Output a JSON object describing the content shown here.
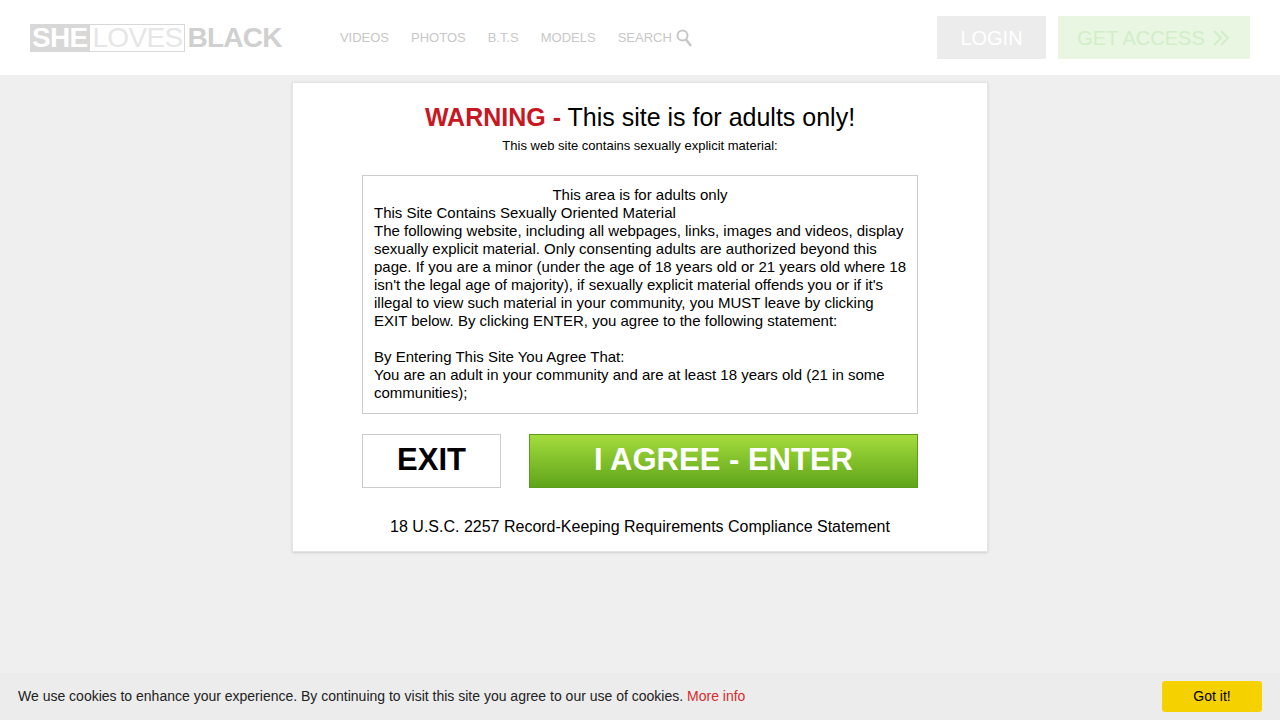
{
  "header": {
    "logo": [
      "SHE",
      "LOVES",
      "BLACK"
    ],
    "nav": [
      "VIDEOS",
      "PHOTOS",
      "B.T.S",
      "MODELS",
      "SEARCH"
    ],
    "login": "LOGIN",
    "get_access": "GET ACCESS"
  },
  "modal": {
    "warning_label": "WARNING -",
    "title": "This site is for adults only!",
    "subtitle": "This web site contains sexually explicit material:",
    "terms": {
      "heading": "This area is for adults only",
      "lines": [
        "This Site Contains Sexually Oriented Material",
        "The following website, including all webpages, links, images and videos, display sexually explicit material. Only consenting adults are authorized beyond this page. If you are a minor (under the age of 18 years old or 21 years old where 18 isn't the legal age of majority), if sexually explicit material offends you or if it's illegal to view such material in your community, you MUST leave by clicking EXIT below. By clicking ENTER, you agree to the following statement:",
        "",
        "By Entering This Site You Agree That:",
        "You are an adult in your community and are at least 18 years old (21 in some communities);"
      ]
    },
    "exit": "EXIT",
    "enter": "I AGREE - ENTER",
    "compliance": "18 U.S.C. 2257 Record-Keeping Requirements Compliance Statement"
  },
  "cookie": {
    "text": "We use cookies to enhance your experience. By continuing to visit this site you agree to our use of cookies.",
    "link": "More info",
    "button": "Got it!"
  }
}
